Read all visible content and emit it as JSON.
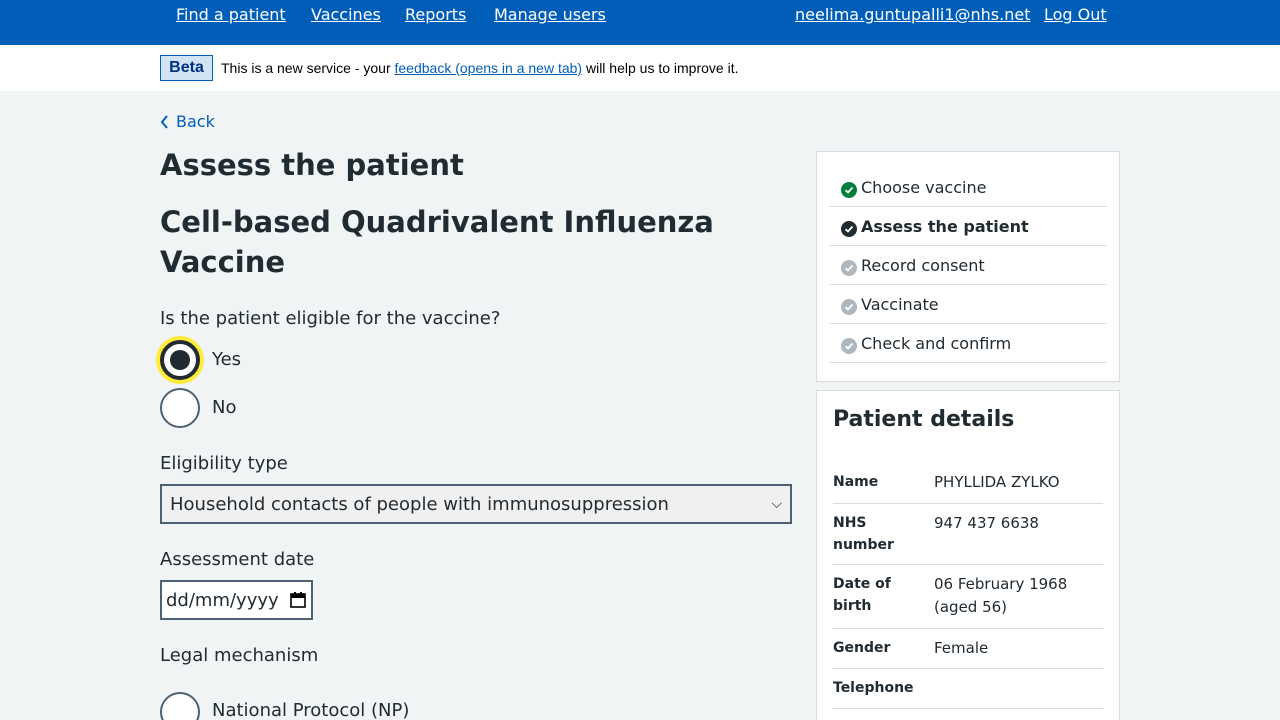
{
  "header": {
    "nav": [
      "Find a patient",
      "Vaccines",
      "Reports",
      "Manage users"
    ],
    "user_email": "neelima.guntupalli1@nhs.net",
    "logout": "Log Out"
  },
  "beta": {
    "tag": "Beta",
    "text_before": "This is a new service - your ",
    "link": "feedback (opens in a new tab)",
    "text_after": " will help us to improve it."
  },
  "back": "Back",
  "page_title": "Assess the patient",
  "vaccine_title": "Cell-based Quadrivalent Influenza Vaccine",
  "eligibility_question": "Is the patient eligible for the vaccine?",
  "eligibility_options": [
    {
      "label": "Yes",
      "checked": true
    },
    {
      "label": "No",
      "checked": false
    }
  ],
  "eligibility_type": {
    "label": "Eligibility type",
    "selected": "Household contacts of people with immunosuppression"
  },
  "assessment_date": {
    "label": "Assessment date",
    "placeholder": "dd/mm/yyyy"
  },
  "legal_mechanism": {
    "label": "Legal mechanism",
    "first_option": "National Protocol (NP)"
  },
  "tasks": [
    {
      "label": "Choose vaccine",
      "status": "done"
    },
    {
      "label": "Assess the patient",
      "status": "current"
    },
    {
      "label": "Record consent",
      "status": "todo"
    },
    {
      "label": "Vaccinate",
      "status": "todo"
    },
    {
      "label": "Check and confirm",
      "status": "todo"
    }
  ],
  "patient": {
    "title": "Patient details",
    "name_label": "Name",
    "name": "PHYLLIDA ZYLKO",
    "nhs_label": "NHS number",
    "nhs": "947 437 6638",
    "dob_label": "Date of birth",
    "dob": "06 February 1968 (aged 56)",
    "gender_label": "Gender",
    "gender": "Female",
    "telephone_label": "Telephone",
    "telephone": ""
  },
  "colors": {
    "brand_blue": "#005eb8",
    "done_green": "#007f3b",
    "focus_yellow": "#ffeb3b",
    "todo_grey": "#aeb7bd"
  }
}
